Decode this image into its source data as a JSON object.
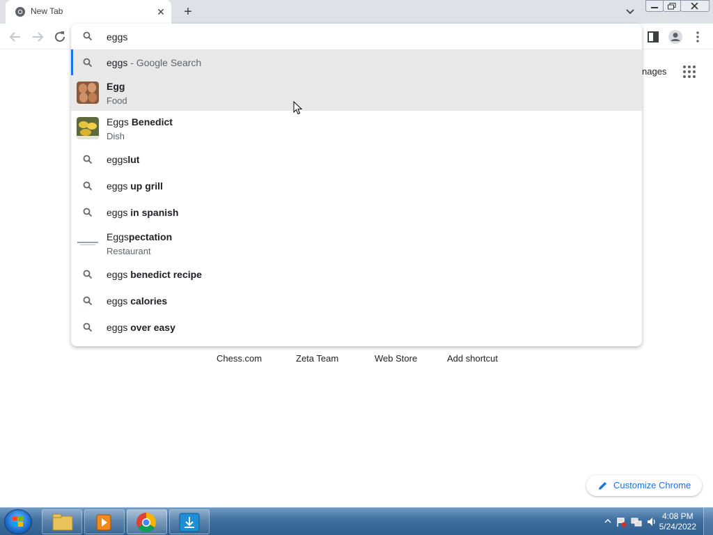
{
  "tab": {
    "title": "New Tab",
    "close_glyph": "✕",
    "favicon": "chrome-icon"
  },
  "newtab_glyph": "+",
  "omnibox": {
    "value": "eggs",
    "suggestions": [
      {
        "prefix": "eggs",
        "bold": "",
        "suffix": " - Google Search",
        "sub": "",
        "icon": "search-icon"
      },
      {
        "prefix": "",
        "bold": "Egg",
        "suffix": "",
        "sub": "Food",
        "icon": "egg-thumbnail"
      },
      {
        "prefix": "Eggs ",
        "bold": "Benedict",
        "suffix": "",
        "sub": "Dish",
        "icon": "eggs-benedict-thumbnail"
      },
      {
        "prefix": "eggs",
        "bold": "lut",
        "suffix": "",
        "sub": "",
        "icon": "search-icon"
      },
      {
        "prefix": "eggs",
        "bold": " up grill",
        "suffix": "",
        "sub": "",
        "icon": "search-icon"
      },
      {
        "prefix": "eggs",
        "bold": " in spanish",
        "suffix": "",
        "sub": "",
        "icon": "search-icon"
      },
      {
        "prefix": "Eggs",
        "bold": "pectation",
        "suffix": "",
        "sub": "Restaurant",
        "icon": "eggspectation-logo"
      },
      {
        "prefix": "eggs",
        "bold": " benedict recipe",
        "suffix": "",
        "sub": "",
        "icon": "search-icon"
      },
      {
        "prefix": "eggs",
        "bold": " calories",
        "suffix": "",
        "sub": "",
        "icon": "search-icon"
      },
      {
        "prefix": "eggs",
        "bold": " over easy",
        "suffix": "",
        "sub": "",
        "icon": "search-icon"
      }
    ]
  },
  "page": {
    "images_link": "nages",
    "shortcuts": [
      "Chess.com",
      "Zeta Team",
      "Web Store",
      "Add shortcut"
    ],
    "customize_label": "Customize Chrome"
  },
  "taskbar": {
    "time": "4:08 PM",
    "date": "5/24/2022"
  },
  "colors": {
    "accent": "#1a73e8",
    "hover": "#e8e8e9",
    "tabstrip": "#dee1e6"
  }
}
